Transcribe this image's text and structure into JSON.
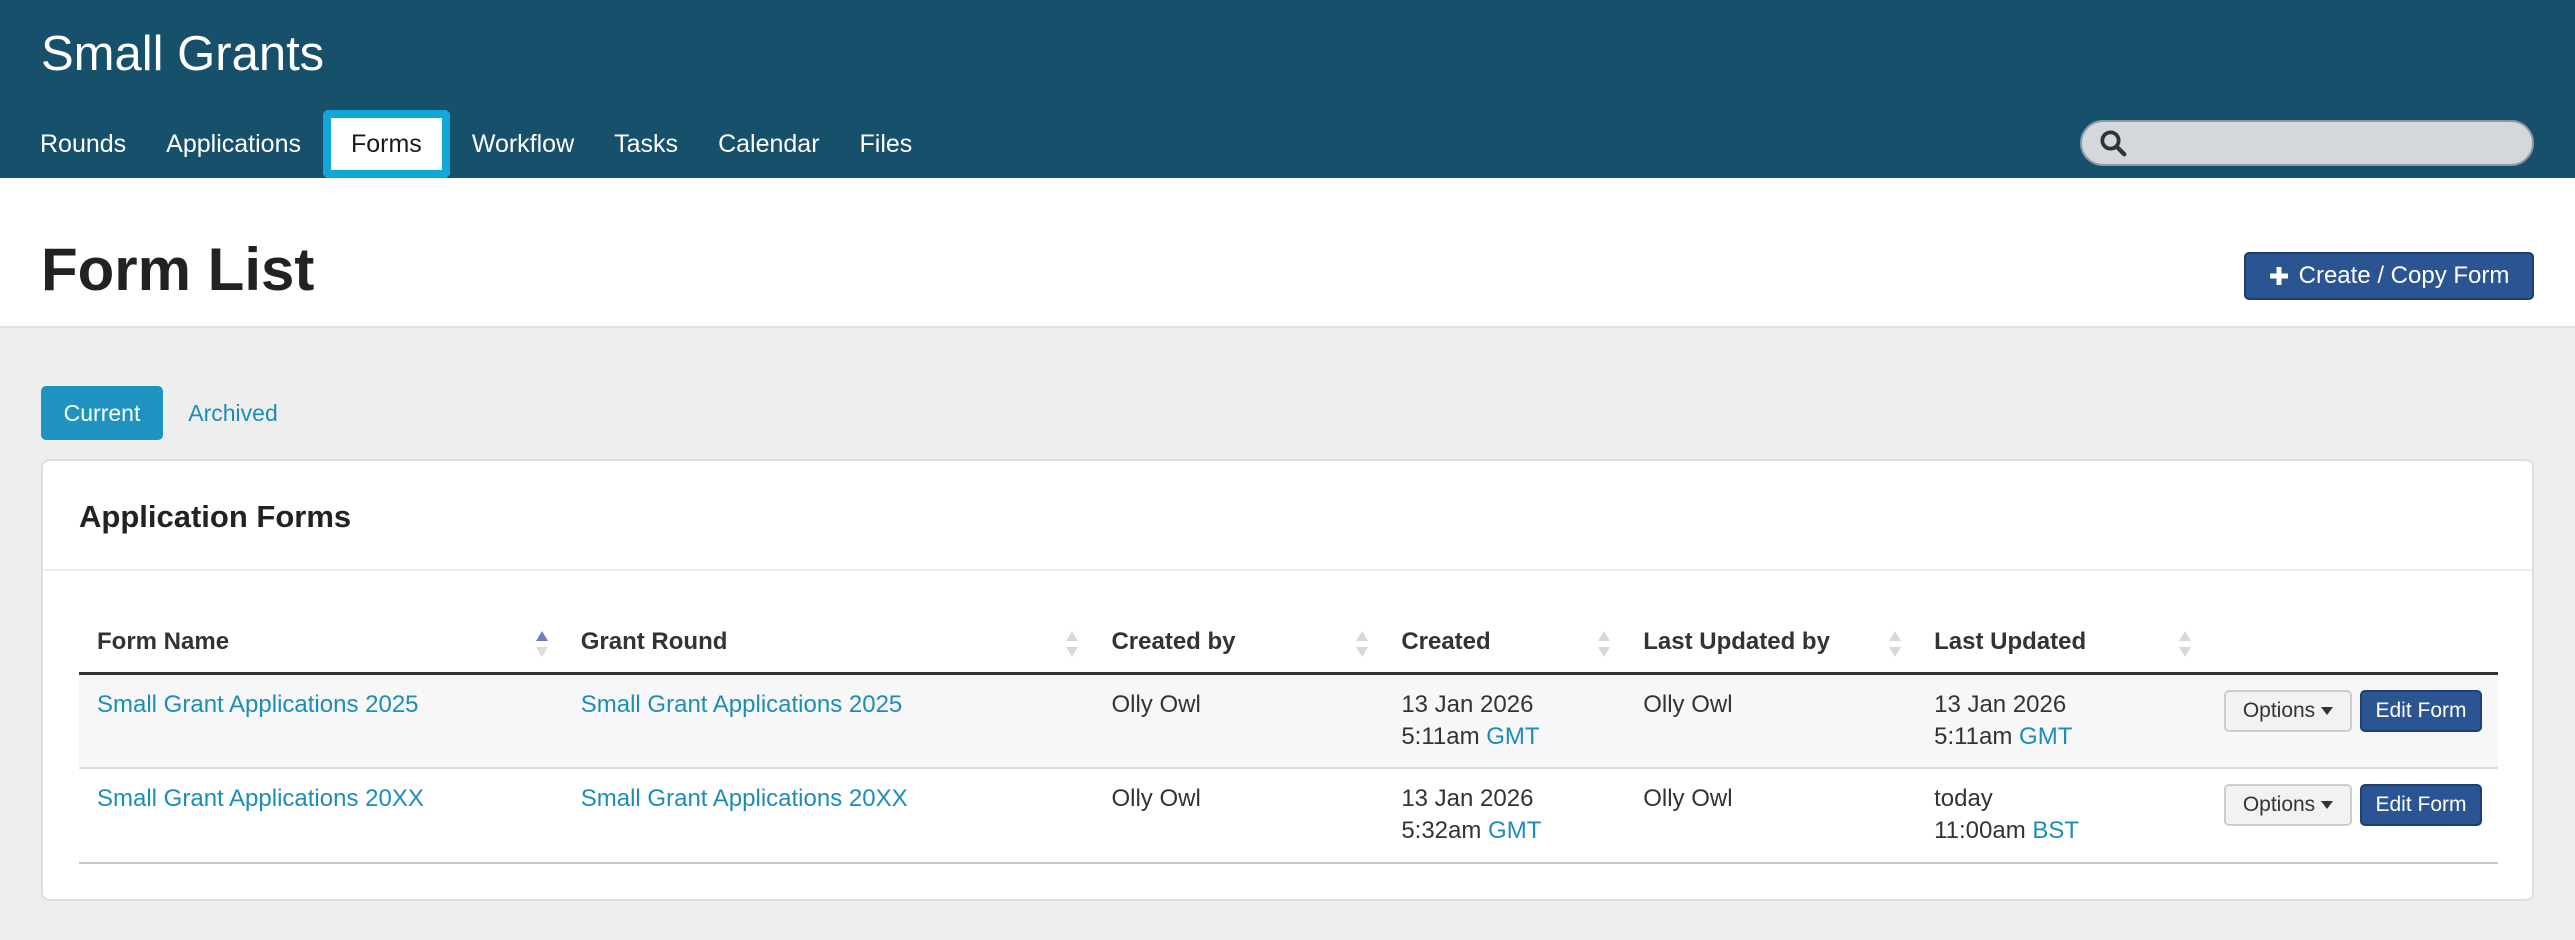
{
  "app": {
    "title": "Small Grants"
  },
  "nav": {
    "items": [
      {
        "label": "Rounds"
      },
      {
        "label": "Applications"
      },
      {
        "label": "Forms",
        "active": true
      },
      {
        "label": "Workflow"
      },
      {
        "label": "Tasks"
      },
      {
        "label": "Calendar"
      },
      {
        "label": "Files"
      }
    ]
  },
  "search": {
    "placeholder": "",
    "value": "",
    "icon": "search-icon"
  },
  "page": {
    "title": "Form List",
    "create_button_label": "Create / Copy Form"
  },
  "tabs": {
    "current": "Current",
    "archived": "Archived"
  },
  "panel": {
    "title": "Application Forms",
    "columns": [
      "Form Name",
      "Grant Round",
      "Created by",
      "Created",
      "Last Updated by",
      "Last Updated"
    ],
    "rows": [
      {
        "form_name": "Small Grant Applications 2025",
        "grant_round": "Small Grant Applications 2025",
        "created_by": "Olly Owl",
        "created_date": "13 Jan 2026",
        "created_time": "5:11am",
        "created_tz": "GMT",
        "updated_by": "Olly Owl",
        "updated_date": "13 Jan 2026",
        "updated_time": "5:11am",
        "updated_tz": "GMT",
        "options_label": "Options",
        "edit_label": "Edit Form"
      },
      {
        "form_name": "Small Grant Applications 20XX",
        "grant_round": "Small Grant Applications 20XX",
        "created_by": "Olly Owl",
        "created_date": "13 Jan 2026",
        "created_time": "5:32am",
        "created_tz": "GMT",
        "updated_by": "Olly Owl",
        "updated_date": "today",
        "updated_time": "11:00am",
        "updated_tz": "BST",
        "options_label": "Options",
        "edit_label": "Edit Form"
      }
    ]
  },
  "colors": {
    "header_bg": "#17506b",
    "active_tab_outline": "#10a8d8",
    "primary_button": "#2b5592",
    "link": "#1c8db8",
    "current_tab_bg": "#1f93bf"
  }
}
